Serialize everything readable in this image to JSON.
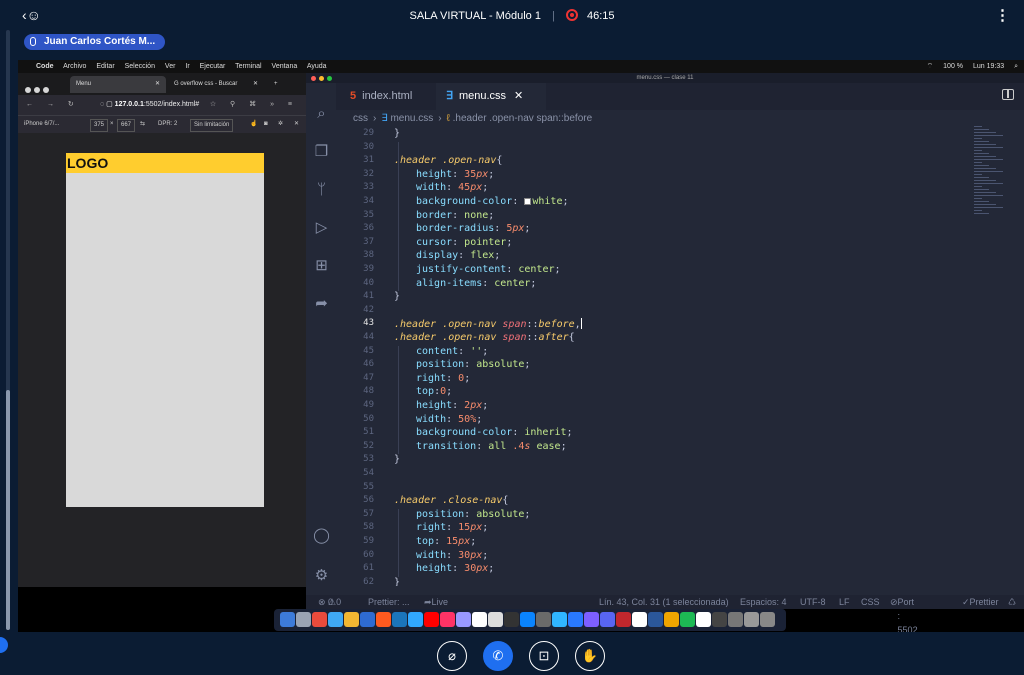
{
  "meeting": {
    "back_icon": "back-user-icon",
    "title": "SALA VIRTUAL - Módulo 1",
    "timer": "46:15",
    "speaker": "Juan Carlos Cortés M...",
    "menu_icon": "kebab-icon"
  },
  "mac_menubar": {
    "items": [
      "Code",
      "Archivo",
      "Editar",
      "Selección",
      "Ver",
      "Ir",
      "Ejecutar",
      "Terminal",
      "Ventana",
      "Ayuda"
    ],
    "battery": "100 %",
    "clock": "Lun 19:33"
  },
  "browser": {
    "tab_active": "Menu",
    "tab_other": "overflow css - Buscar",
    "url_host": "127.0.0.1",
    "url_path": ":5502/index.html#",
    "device": "iPhone 6/7/...",
    "width": "375",
    "height": "667",
    "dpr": "DPR: 2",
    "throttle": "Sin limitación",
    "page_logo": "LOGO"
  },
  "vscode": {
    "window_title": "menu.css — clase 11",
    "tabs": [
      {
        "label": "index.html",
        "icon": "html-icon"
      },
      {
        "label": "menu.css",
        "icon": "css-icon"
      }
    ],
    "breadcrumb": [
      "css",
      "menu.css",
      ".header .open-nav span::before"
    ],
    "lines": [
      {
        "n": "29",
        "text": "}"
      },
      {
        "n": "30",
        "text": ""
      },
      {
        "n": "31",
        "text": ".header .open-nav{"
      },
      {
        "n": "32",
        "text": "height: 35px;"
      },
      {
        "n": "33",
        "text": "width: 45px;"
      },
      {
        "n": "34",
        "text": "background-color: white;"
      },
      {
        "n": "35",
        "text": "border: none;"
      },
      {
        "n": "36",
        "text": "border-radius: 5px;"
      },
      {
        "n": "37",
        "text": "cursor: pointer;"
      },
      {
        "n": "38",
        "text": "display: flex;"
      },
      {
        "n": "39",
        "text": "justify-content: center;"
      },
      {
        "n": "40",
        "text": "align-items: center;"
      },
      {
        "n": "41",
        "text": "}"
      },
      {
        "n": "42",
        "text": ""
      },
      {
        "n": "43",
        "text": ".header .open-nav span::before,"
      },
      {
        "n": "44",
        "text": ".header .open-nav span::after{"
      },
      {
        "n": "45",
        "text": "content: '';"
      },
      {
        "n": "46",
        "text": "position: absolute;"
      },
      {
        "n": "47",
        "text": "right: 0;"
      },
      {
        "n": "48",
        "text": "top:0;"
      },
      {
        "n": "49",
        "text": "height: 2px;"
      },
      {
        "n": "50",
        "text": "width: 50%;"
      },
      {
        "n": "51",
        "text": "background-color: inherit;"
      },
      {
        "n": "52",
        "text": "transition: all .4s ease;"
      },
      {
        "n": "53",
        "text": "}"
      },
      {
        "n": "54",
        "text": ""
      },
      {
        "n": "55",
        "text": ""
      },
      {
        "n": "56",
        "text": ".header .close-nav{"
      },
      {
        "n": "57",
        "text": "position: absolute;"
      },
      {
        "n": "58",
        "text": "right: 15px;"
      },
      {
        "n": "59",
        "text": "top: 15px;"
      },
      {
        "n": "60",
        "text": "width: 30px;"
      },
      {
        "n": "61",
        "text": "height: 30px;"
      },
      {
        "n": "62",
        "text": "}"
      }
    ],
    "current_line": "43",
    "status": {
      "problems": "0",
      "warnings": "0",
      "prettier_left": "Prettier: ...",
      "live_share": "Live Share",
      "position": "Lín. 43, Col. 31 (1 seleccionada)",
      "spaces": "Espacios: 4",
      "encoding": "UTF-8",
      "eol": "LF",
      "language": "CSS",
      "port": "Port : 5502",
      "prettier_right": "Prettier"
    }
  },
  "controls": {
    "mic": "mic-off-icon",
    "call": "phone-icon",
    "camera": "camera-off-icon",
    "hand": "raise-hand-icon"
  },
  "colors": {
    "meeting_bg": "#0b1c33",
    "speaker_pill": "#2f55c6",
    "record": "#e33333",
    "logo_bar": "#ffcd2e",
    "editor_bg": "#232837"
  }
}
